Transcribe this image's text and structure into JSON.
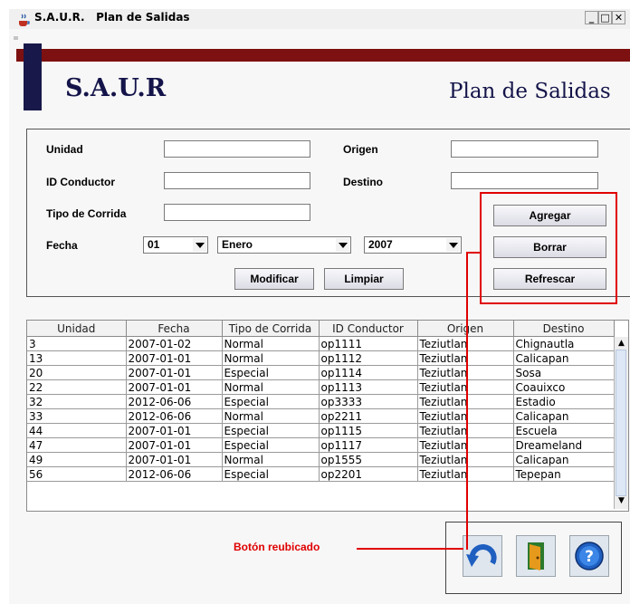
{
  "window": {
    "app_short": "S.A.U.R.",
    "title": "Plan de Salidas",
    "minimize_label": "_",
    "maximize_label": "□",
    "close_label": "✕"
  },
  "header": {
    "app_name": "S.A.U.R",
    "page_title": "Plan de Salidas",
    "bar_color": "#7d1010"
  },
  "form": {
    "unidad_label": "Unidad",
    "unidad_value": "",
    "origen_label": "Origen",
    "origen_value": "",
    "conductor_label": "ID Conductor",
    "conductor_value": "",
    "destino_label": "Destino",
    "destino_value": "",
    "tipo_label": "Tipo de Corrida",
    "tipo_value": "",
    "fecha_label": "Fecha",
    "day": "01",
    "month": "Enero",
    "year": "2007"
  },
  "buttons": {
    "agregar": "Agregar",
    "borrar": "Borrar",
    "refrescar": "Refrescar",
    "modificar": "Modificar",
    "limpiar": "Limpiar"
  },
  "table": {
    "columns": [
      "Unidad",
      "Fecha",
      "Tipo de Corrida",
      "ID Conductor",
      "Origen",
      "Destino"
    ],
    "rows": [
      [
        "3",
        "2007-01-02",
        "Normal",
        "op1111",
        "Teziutlan",
        "Chignautla"
      ],
      [
        "13",
        "2007-01-01",
        "Normal",
        "op1112",
        "Teziutlan",
        "Calicapan"
      ],
      [
        "20",
        "2007-01-01",
        "Especial",
        "op1114",
        "Teziutlan",
        "Sosa"
      ],
      [
        "22",
        "2007-01-01",
        "Normal",
        "op1113",
        "Teziutlan",
        "Coauixco"
      ],
      [
        "32",
        "2012-06-06",
        "Especial",
        "op3333",
        "Teziutlan",
        "Estadio"
      ],
      [
        "33",
        "2012-06-06",
        "Normal",
        "op2211",
        "Teziutlan",
        "Calicapan"
      ],
      [
        "44",
        "2007-01-01",
        "Especial",
        "op1115",
        "Teziutlan",
        "Escuela"
      ],
      [
        "47",
        "2007-01-01",
        "Especial",
        "op1117",
        "Teziutlan",
        "Dreameland"
      ],
      [
        "49",
        "2007-01-01",
        "Normal",
        "op1555",
        "Teziutlan",
        "Calicapan"
      ],
      [
        "56",
        "2012-06-06",
        "Especial",
        "op2201",
        "Teziutlan",
        "Tepepan"
      ]
    ]
  },
  "icons": {
    "undo": "undo-icon",
    "exit": "exit-door-icon",
    "help": "help-icon"
  },
  "annotation": {
    "text": "Botón reubicado",
    "color": "#e00000"
  }
}
